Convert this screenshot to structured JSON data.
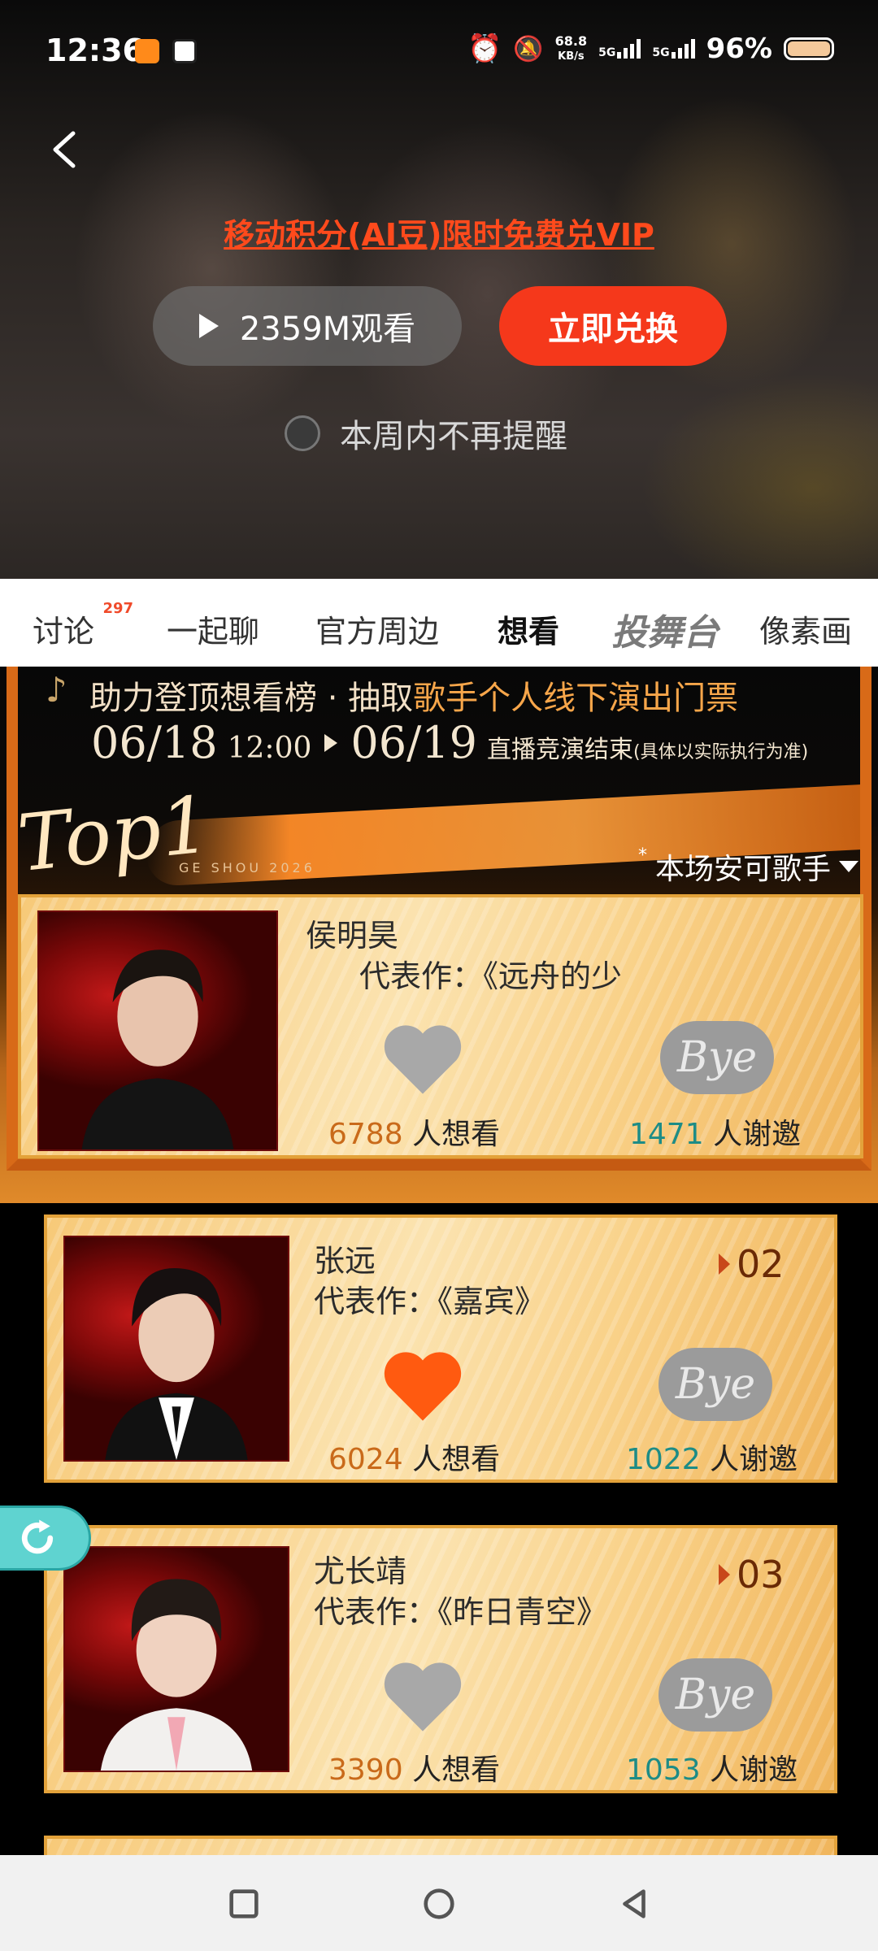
{
  "status_bar": {
    "time": "12:36",
    "net_speed_value": "68.8",
    "net_speed_unit": "KB/s",
    "sig1": "5G",
    "sig2": "5G",
    "battery": "96%"
  },
  "hero": {
    "promo": "移动积分(AI豆)限时免费兑VIP",
    "watch_label": "2359M观看",
    "redeem_label": "立即兑换",
    "remind_label": "本周内不再提醒"
  },
  "tabs": [
    {
      "label": "讨论",
      "badge": "297"
    },
    {
      "label": "一起聊"
    },
    {
      "label": "官方周边"
    },
    {
      "label": "想看"
    },
    {
      "label": "投舞台"
    },
    {
      "label": "像素画"
    }
  ],
  "campaign": {
    "title_prefix": "助力登顶想看榜 · 抽取",
    "title_highlight": "歌手个人线下演出门票",
    "date_start": "06/18",
    "time_start": "12:00",
    "date_end": "06/19",
    "desc": "直播竞演结束",
    "desc_note": "(具体以实际执行为准)",
    "top_label": "Top1",
    "sub_brand": "GE SHOU 2026",
    "singer_filter": "本场安可歌手"
  },
  "artists": [
    {
      "name": "侯明昊",
      "works": "代表作：《远舟的少",
      "rank": "",
      "want": "6788",
      "want_label": "人想看",
      "bye": "1471",
      "bye_label": "人谢邀",
      "liked": false,
      "bye_text": "Bye"
    },
    {
      "name": "张远",
      "works": "代表作：《嘉宾》",
      "rank": "02",
      "want": "6024",
      "want_label": "人想看",
      "bye": "1022",
      "bye_label": "人谢邀",
      "liked": true,
      "bye_text": "Bye"
    },
    {
      "name": "尤长靖",
      "works": "代表作：《昨日青空》",
      "rank": "03",
      "want": "3390",
      "want_label": "人想看",
      "bye": "1053",
      "bye_label": "人谢邀",
      "liked": false,
      "bye_text": "Bye"
    }
  ],
  "colors": {
    "accent_red": "#f5381b",
    "promo_red": "#ff4a1c",
    "heart_active": "#ff5a10",
    "heart_inactive": "#a8a8a8",
    "want_count": "#c96a1a",
    "bye_count": "#1d8c86"
  },
  "icons": {
    "back": "chevron-left-icon",
    "play": "play-icon",
    "heart": "heart-icon",
    "refresh": "refresh-icon",
    "nav_recent": "square-icon",
    "nav_home": "circle-icon",
    "nav_back": "triangle-back-icon"
  }
}
